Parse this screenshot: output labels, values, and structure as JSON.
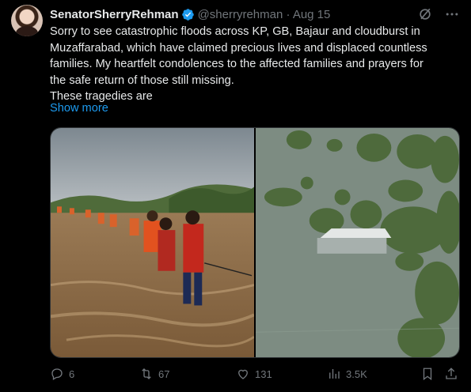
{
  "tweet": {
    "author_name": "SenatorSherryRehman",
    "handle_time": "@sherryrehman · Aug 15",
    "text_lines": [
      "Sorry to see catastrophic floods across KP, GB, Bajaur and cloudburst in",
      "Muzaffarabad, which have claimed precious lives and displaced countless",
      "families. My heartfelt condolences to the affected families and prayers for",
      "the safe return of those still missing.",
      "These tragedies are"
    ],
    "show_more": "Show more"
  },
  "icons": {
    "verified": "verified-badge-icon",
    "grok": "grok-icon",
    "more": "more-icon",
    "reply": "reply-icon",
    "retweet": "retweet-icon",
    "like": "like-icon",
    "views": "views-icon",
    "bookmark": "bookmark-icon",
    "share": "share-icon"
  },
  "metrics": {
    "replies": "6",
    "reposts": "67",
    "likes": "131",
    "views": "3.5K"
  },
  "colors": {
    "background": "#000000",
    "text": "#e7e9ea",
    "secondary": "#71767b",
    "link": "#1d9bf0",
    "verified": "#1d9bf0"
  }
}
